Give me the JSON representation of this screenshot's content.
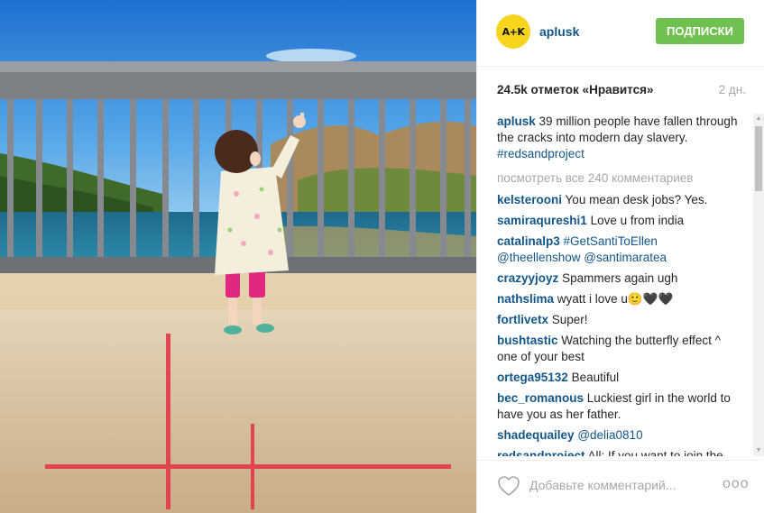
{
  "post": {
    "photo_description_icon": "photo-icon",
    "avatar_text": "A+K",
    "username": "aplusk",
    "follow_label": "ПОДПИСКИ",
    "likes": "24.5k отметок «Нравится»",
    "time": "2 дн.",
    "caption": {
      "user": "aplusk",
      "text": "39 million people have fallen through the cracks into modern day slavery.",
      "tag": "#redsandproject"
    },
    "view_all": "посмотреть все 240 комментариев",
    "comments": [
      {
        "user": "kelsterooni",
        "text": "You mean desk jobs? Yes."
      },
      {
        "user": "samiraqureshi1",
        "text": "Love u from india"
      },
      {
        "user": "catalinalp3",
        "text": "#GetSantiToEllen @theellenshow @santimaratea"
      },
      {
        "user": "crazyyjoyz",
        "text": "Spammers again ugh"
      },
      {
        "user": "nathslima",
        "text": "wyatt i love u🙂🖤🖤"
      },
      {
        "user": "fortlivetx",
        "text": "Super!"
      },
      {
        "user": "bushtastic",
        "text": "Watching the butterfly effect ^ one of your best"
      },
      {
        "user": "ortega95132",
        "text": "Beautiful"
      },
      {
        "user": "bec_romanous",
        "text": "Luckiest girl in the world to have you as her father."
      },
      {
        "user": "shadequailey",
        "text": "@delia0810"
      },
      {
        "user": "redsandproject",
        "text": "All: If you want to join the"
      }
    ],
    "comment_placeholder": "Добавьте комментарий...",
    "more_label": "ooo"
  },
  "colors": {
    "link": "#125688",
    "follow_button": "#70c050",
    "muted": "#a5a7aa",
    "avatar": "#f7d41e"
  }
}
